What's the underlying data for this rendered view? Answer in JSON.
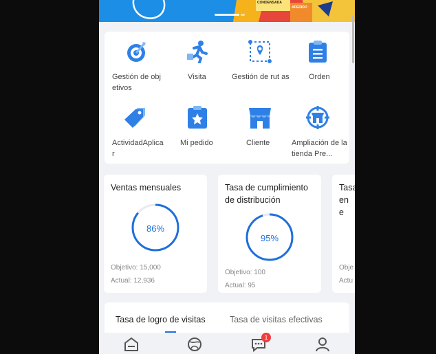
{
  "accent_color": "#1d6fdc",
  "icon_color": "#2f80e6",
  "banner_color": "#1d8ee6",
  "banner": {
    "poster_text_1": "CONDENSADA",
    "poster_text_2": "APEDIDO"
  },
  "quick_actions": [
    {
      "label": "Gestión de obj etivos",
      "icon": "target-icon"
    },
    {
      "label": "Visita",
      "icon": "running-person-icon"
    },
    {
      "label": "Gestión de rut as",
      "icon": "route-map-icon"
    },
    {
      "label": "Orden",
      "icon": "clipboard-list-icon"
    },
    {
      "label": "ActividadAplica r",
      "icon": "price-tag-icon"
    },
    {
      "label": "Mi pedido",
      "icon": "order-star-icon"
    },
    {
      "label": "Cliente",
      "icon": "store-icon"
    },
    {
      "label": "Ampliación de la tienda Pre...",
      "icon": "store-location-icon"
    }
  ],
  "stats": [
    {
      "title": "Ventas mensuales",
      "percent": 86,
      "percent_label": "86%",
      "objective": "Objetivo: 15,000",
      "actual": "Actual: 12,936"
    },
    {
      "title": "Tasa de cumplimiento de distribución",
      "percent": 95,
      "percent_label": "95%",
      "objective": "Objetivo: 100",
      "actual": "Actual: 95"
    },
    {
      "title": "Tasa en e",
      "objective": "Obje",
      "actual": "Actu"
    }
  ],
  "tabs": [
    {
      "label": "Tasa de logro de visitas",
      "active": true
    },
    {
      "label": "Tasa de visitas efectivas",
      "active": false
    }
  ],
  "bottom_nav": [
    {
      "icon": "home-icon"
    },
    {
      "icon": "globe-icon"
    },
    {
      "icon": "chat-icon",
      "badge": "1"
    },
    {
      "icon": "user-icon"
    }
  ]
}
